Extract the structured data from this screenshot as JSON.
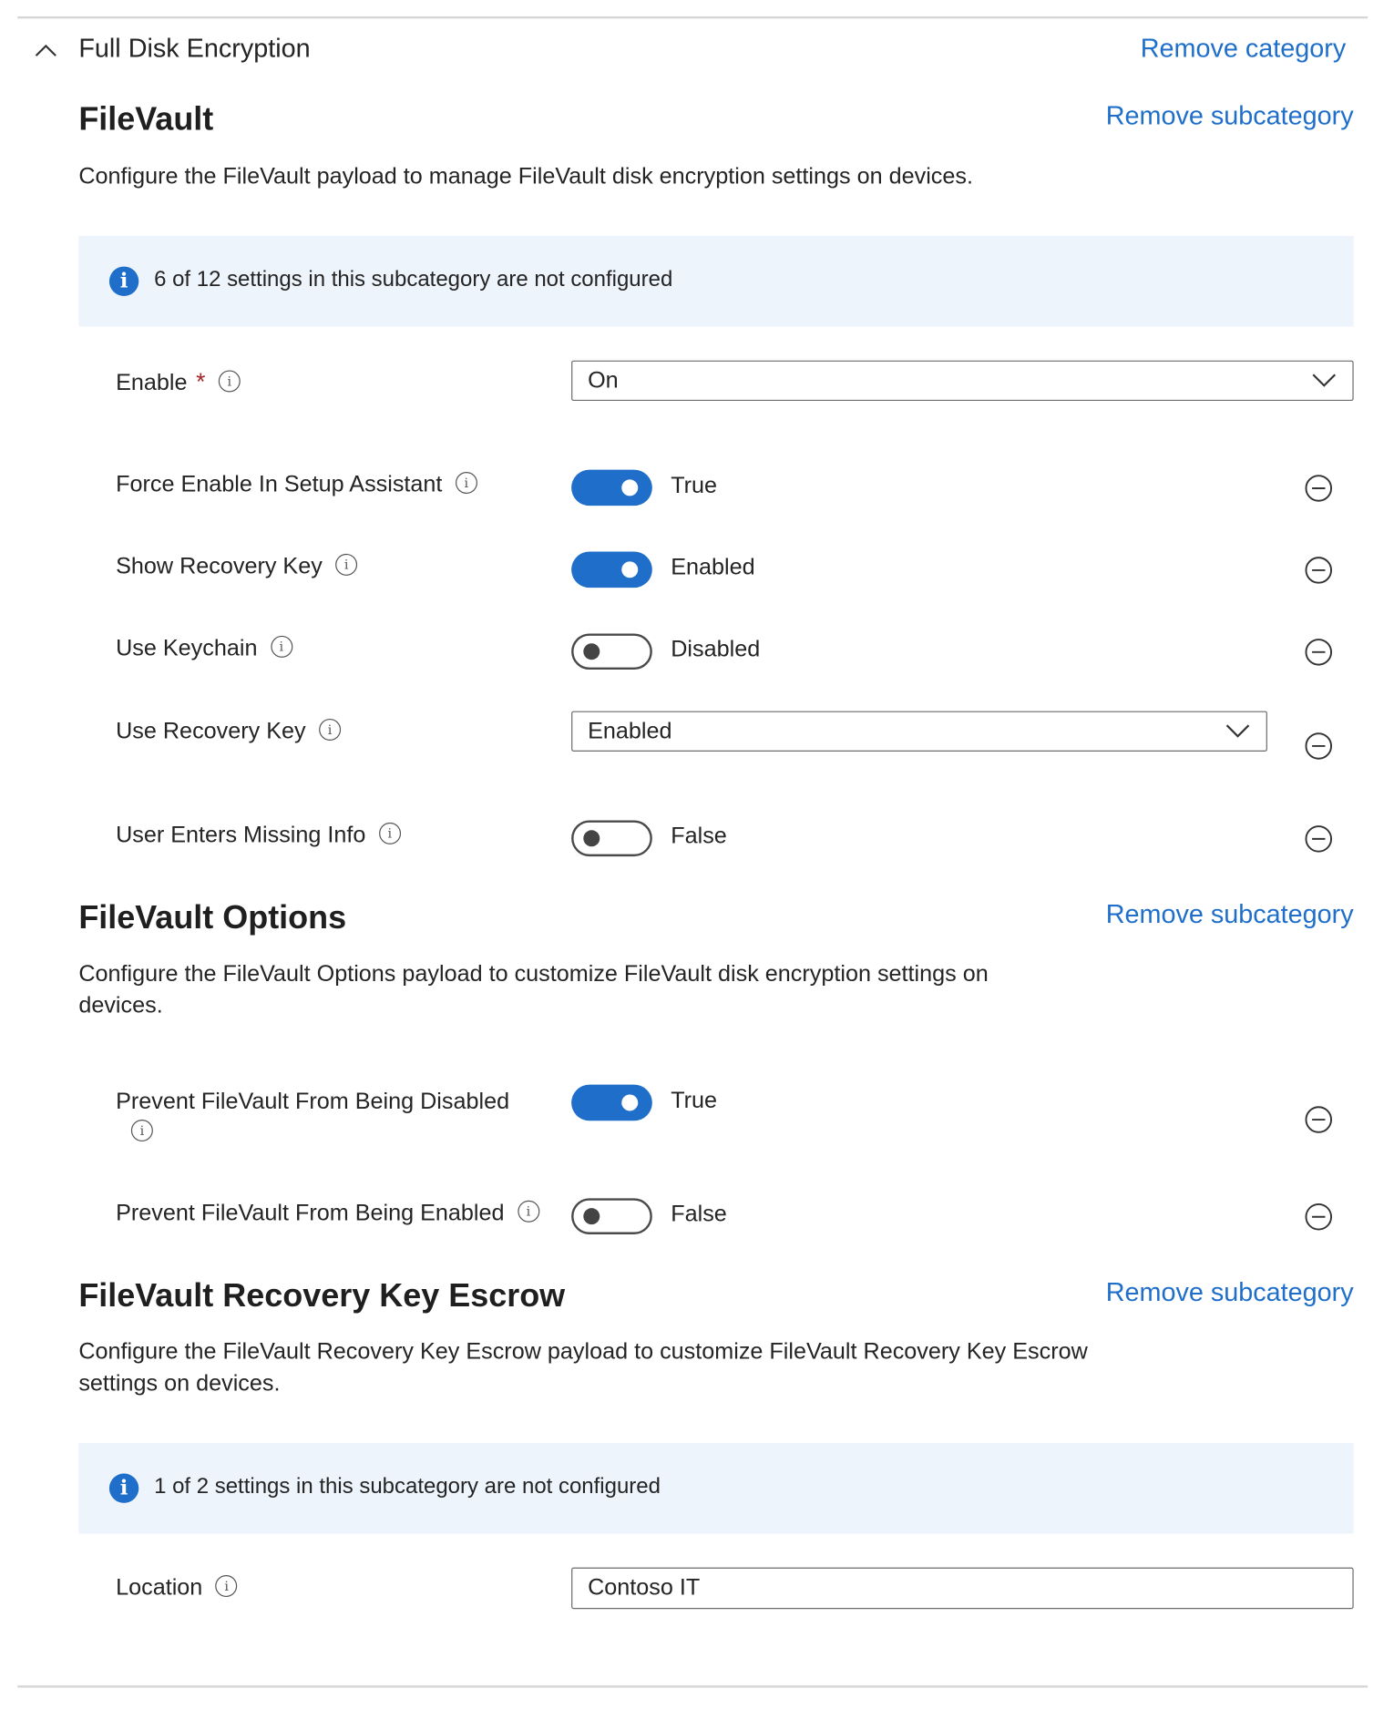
{
  "category": {
    "title": "Full Disk Encryption",
    "remove_label": "Remove category"
  },
  "filevault": {
    "title": "FileVault",
    "remove_label": "Remove subcategory",
    "description": "Configure the FileVault payload to manage FileVault disk encryption settings on devices.",
    "banner": "6 of 12 settings in this subcategory are not configured",
    "enable": {
      "label": "Enable",
      "required_mark": "*",
      "value": "On"
    },
    "force_enable": {
      "label": "Force Enable In Setup Assistant",
      "value": "True",
      "on": true
    },
    "show_recovery_key": {
      "label": "Show Recovery Key",
      "value": "Enabled",
      "on": true
    },
    "use_keychain": {
      "label": "Use Keychain",
      "value": "Disabled",
      "on": false
    },
    "use_recovery_key": {
      "label": "Use Recovery Key",
      "value": "Enabled"
    },
    "user_enters_missing_info": {
      "label": "User Enters Missing Info",
      "value": "False",
      "on": false
    }
  },
  "filevault_options": {
    "title": "FileVault Options",
    "remove_label": "Remove subcategory",
    "description": "Configure the FileVault Options payload to customize FileVault disk encryption settings on devices.",
    "prevent_disabled": {
      "label": "Prevent FileVault From Being Disabled",
      "value": "True",
      "on": true
    },
    "prevent_enabled": {
      "label": "Prevent FileVault From Being Enabled",
      "value": "False",
      "on": false
    }
  },
  "escrow": {
    "title": "FileVault Recovery Key Escrow",
    "remove_label": "Remove subcategory",
    "description": "Configure the FileVault Recovery Key Escrow payload to customize FileVault Recovery Key Escrow settings on devices.",
    "banner": "1 of 2 settings in this subcategory are not configured",
    "location": {
      "label": "Location",
      "value": "Contoso IT"
    }
  },
  "icons": {
    "collapse": "chevron-up-icon",
    "info": "info-icon",
    "remove": "remove-setting-icon",
    "dropdown": "chevron-down-icon"
  },
  "colors": {
    "accent": "#1f6fca",
    "banner_bg": "#eef4fc",
    "required": "#a4262c"
  }
}
